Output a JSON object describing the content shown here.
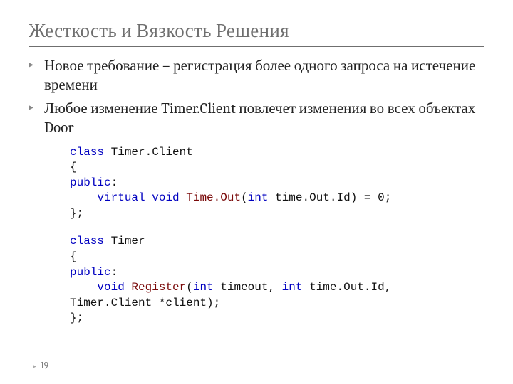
{
  "title": "Жесткость и Вязкость Решения",
  "bullets": [
    "Новое требование – регистрация более одного запроса на истечение время",
    "Любое изменение Timer.Client повлечет изменения во всех объектах Door"
  ],
  "bulletA_1": "Новое требование – регистрация более одного запроса на истечение времени",
  "bulletB_1": "Любое изменение Timer.Client повлечет изменения во всех объектах Door",
  "code1": {
    "l1_kw": "class",
    "l1_rest": " Timer.Client",
    "l2": "{",
    "l3_kw": "public",
    "l3_rest": ":",
    "l4_pre": "    ",
    "l4_kw1": "virtual",
    "l4_sp1": " ",
    "l4_kw2": "void",
    "l4_sp2": " ",
    "l4_fn": "Time.Out",
    "l4_paren_open": "(",
    "l4_kw3": "int",
    "l4_rest": " time.Out.Id) = 0;",
    "l5": "};"
  },
  "code2": {
    "l1_kw": "class",
    "l1_rest": " Timer",
    "l2": "{",
    "l3_kw": "public",
    "l3_rest": ":",
    "l4_pre": "    ",
    "l4_kw1": "void",
    "l4_sp1": " ",
    "l4_fn": "Register",
    "l4_paren_open": "(",
    "l4_kw2": "int",
    "l4_mid": " timeout, ",
    "l4_kw3": "int",
    "l4_rest": " time.Out.Id,",
    "l5": "Timer.Client *client);",
    "l6": "};"
  },
  "pagenum": "19"
}
